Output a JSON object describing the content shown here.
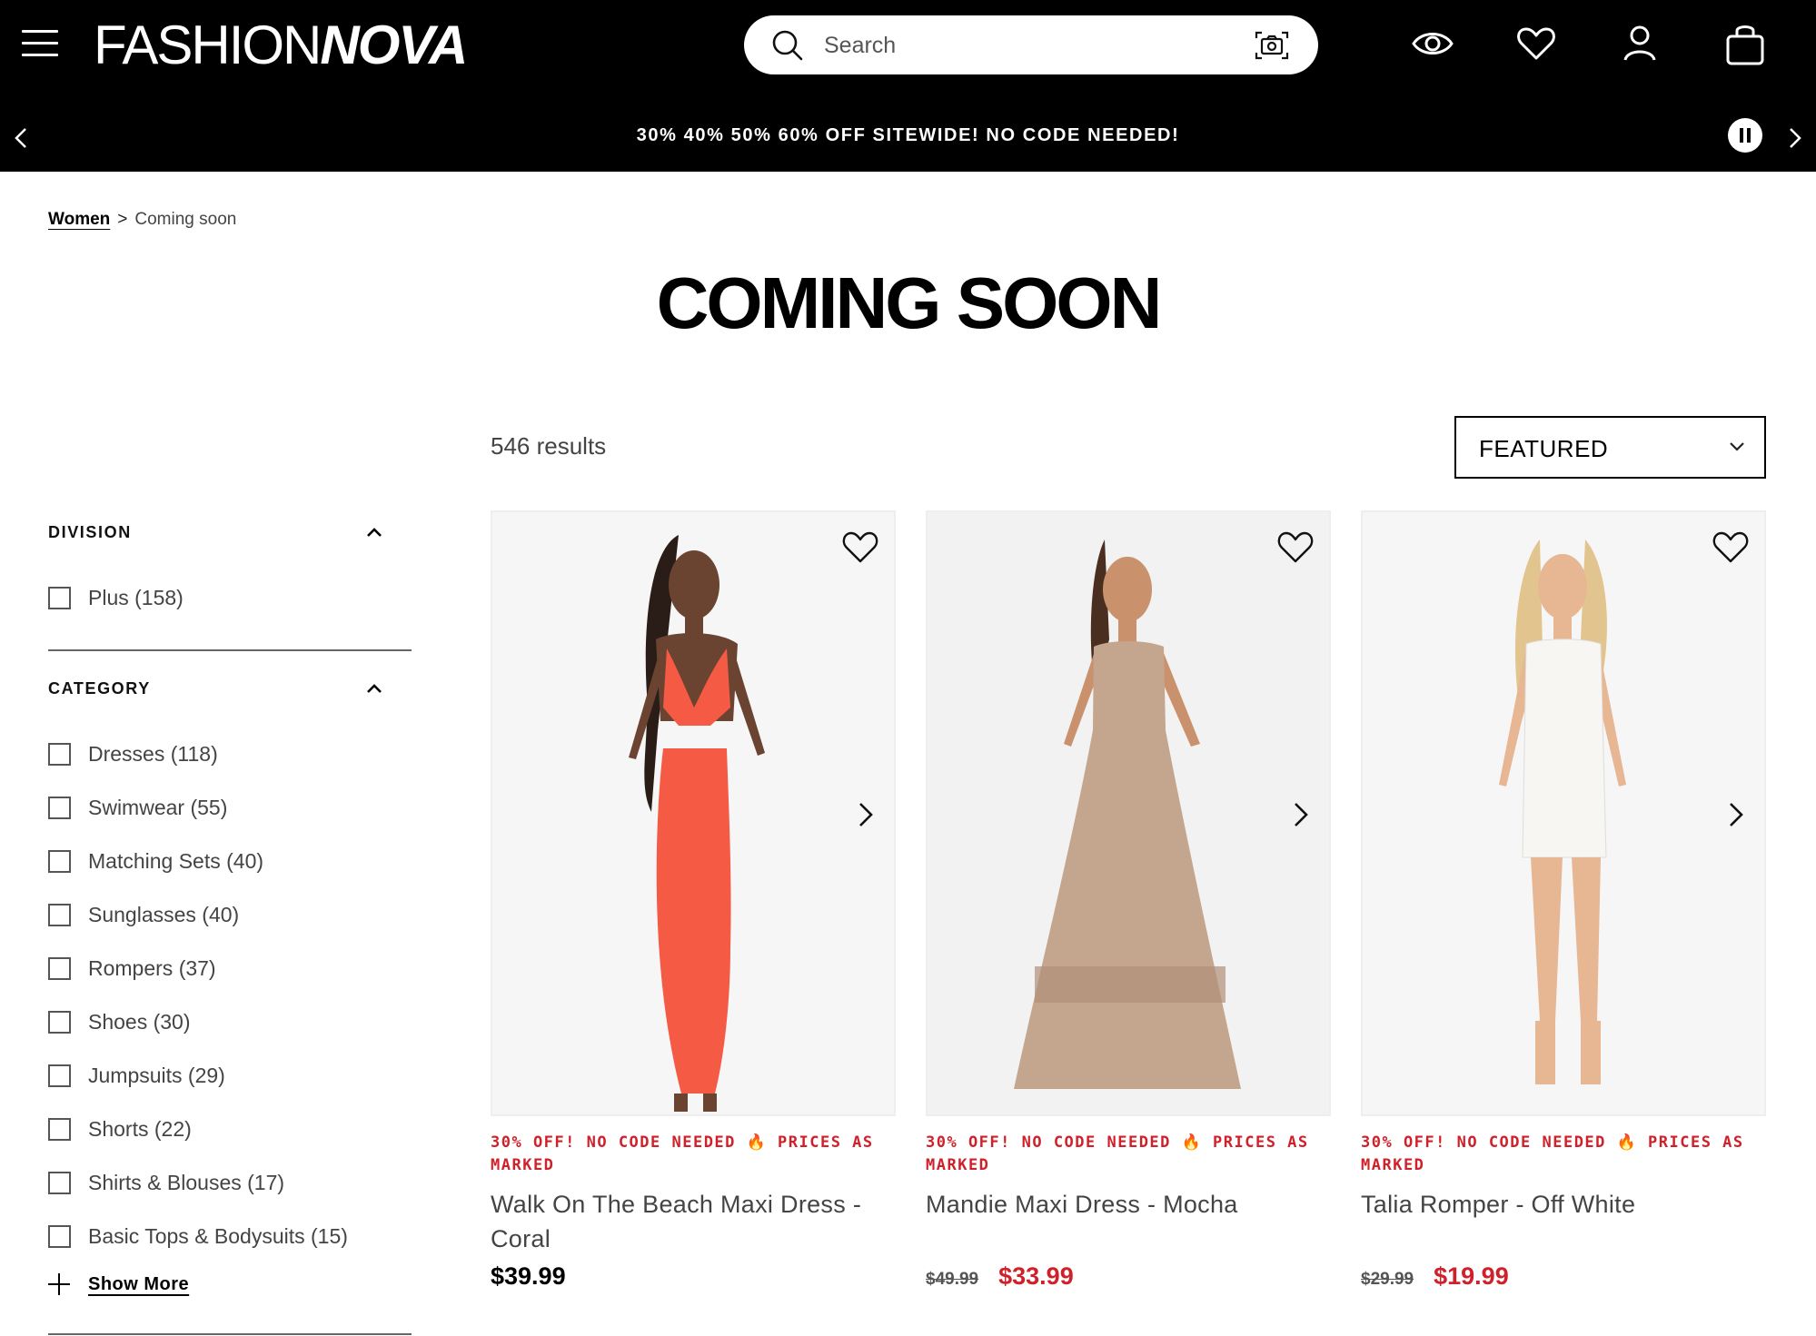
{
  "header": {
    "logo_part1": "FASHION",
    "logo_part2": "NOVA",
    "search_placeholder": "Search",
    "icons": [
      "menu-icon",
      "search-icon",
      "camera-search-icon",
      "eye-icon",
      "heart-icon",
      "account-icon",
      "bag-icon"
    ]
  },
  "promo_banner": {
    "text": "30% 40% 50% 60% OFF SITEWIDE! NO CODE NEEDED!"
  },
  "breadcrumb": {
    "parent": "Women",
    "separator": ">",
    "current": "Coming soon"
  },
  "page": {
    "title": "COMING SOON",
    "results": "546 results",
    "sort_label": "FEATURED"
  },
  "filters": {
    "division": {
      "title": "DIVISION",
      "options": [
        "Plus (158)"
      ]
    },
    "category": {
      "title": "CATEGORY",
      "options": [
        "Dresses (118)",
        "Swimwear (55)",
        "Matching Sets (40)",
        "Sunglasses (40)",
        "Rompers (37)",
        "Shoes (30)",
        "Jumpsuits (29)",
        "Shorts (22)",
        "Shirts & Blouses (17)",
        "Basic Tops & Bodysuits (15)"
      ],
      "show_more": "Show More"
    }
  },
  "products": [
    {
      "promo": "30% OFF! NO CODE NEEDED 🔥 PRICES AS MARKED",
      "name": "Walk On The Beach Maxi Dress - Coral",
      "price": "$39.99",
      "old_price": "",
      "color": "#f55a45"
    },
    {
      "promo": "30% OFF! NO CODE NEEDED 🔥 PRICES AS MARKED",
      "name": "Mandie Maxi Dress - Mocha",
      "price": "$33.99",
      "old_price": "$49.99",
      "color": "#c4a58d"
    },
    {
      "promo": "30% OFF! NO CODE NEEDED 🔥 PRICES AS MARKED",
      "name": "Talia Romper - Off White",
      "price": "$19.99",
      "old_price": "$29.99",
      "color": "#f7f6f2"
    }
  ],
  "colors": {
    "header_bg": "#000000",
    "sale_red": "#d0202a",
    "text_gray": "#444444"
  }
}
